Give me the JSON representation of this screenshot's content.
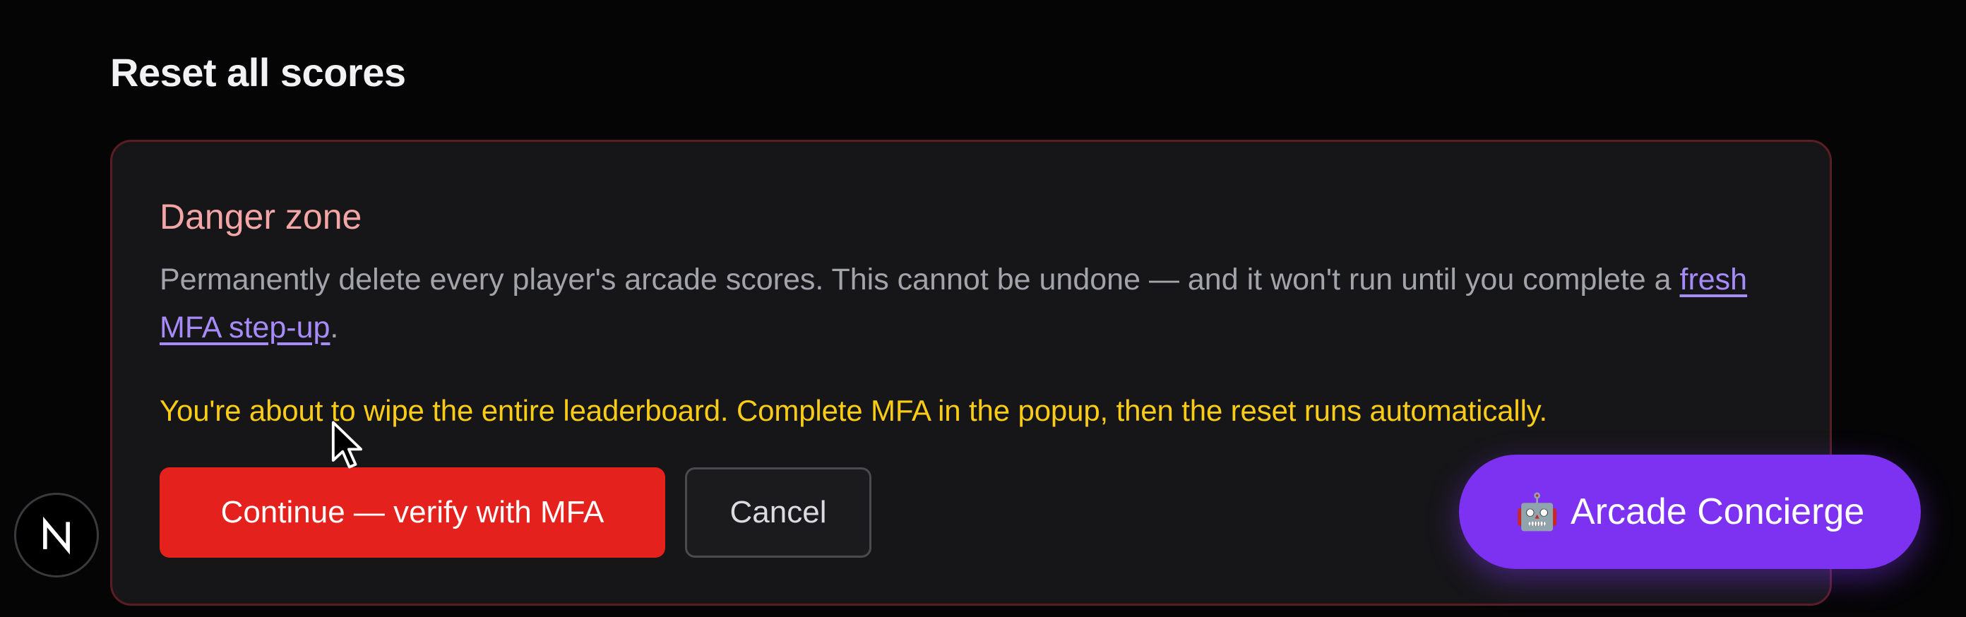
{
  "page": {
    "title": "Reset all scores"
  },
  "danger_zone": {
    "heading": "Danger zone",
    "description_before_link": "Permanently delete every player's arcade scores. This cannot be undone — and it won't run until you complete a ",
    "link_text": "fresh MFA step-up",
    "description_after_link": ".",
    "warning": "You're about to wipe the entire leaderboard. Complete MFA in the popup, then the reset runs automatically.",
    "continue_label": "Continue — verify with MFA",
    "cancel_label": "Cancel"
  },
  "concierge": {
    "icon": "🤖",
    "label": "Arcade Concierge"
  },
  "dev_badge": {
    "icon": "nextjs-logo-icon"
  },
  "colors": {
    "background": "#050506",
    "card_background": "#161618",
    "card_border": "#5b1d24",
    "danger_heading": "#f4a6a6",
    "warning": "#facc15",
    "link": "#a78bfa",
    "danger_button": "#e5211d",
    "concierge_button": "#7c32f0"
  }
}
